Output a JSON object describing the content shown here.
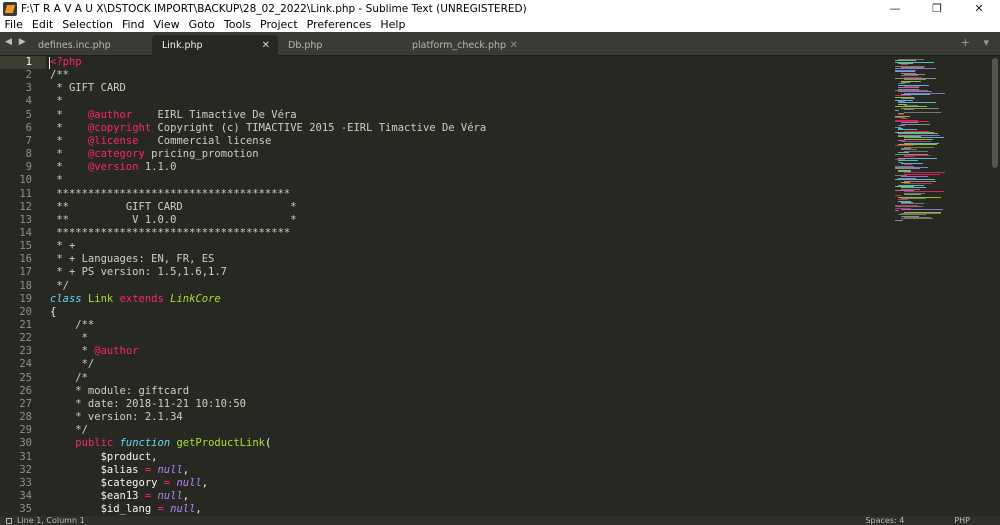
{
  "window": {
    "title": "F:\\T R A V A U X\\DSTOCK IMPORT\\BACKUP\\28_02_2022\\Link.php - Sublime Text (UNREGISTERED)",
    "minimize": "—",
    "maximize": "❐",
    "close": "✕"
  },
  "menu": [
    "File",
    "Edit",
    "Selection",
    "Find",
    "View",
    "Goto",
    "Tools",
    "Project",
    "Preferences",
    "Help"
  ],
  "tabs": [
    {
      "label": "defines.inc.php",
      "active": false
    },
    {
      "label": "Link.php",
      "active": true
    },
    {
      "label": "Db.php",
      "active": false
    },
    {
      "label": "platform_check.php",
      "active": false
    }
  ],
  "tabbar": {
    "nav": "◀ ▶",
    "right": "+ ▾"
  },
  "editor": {
    "current_line": 1,
    "lines": [
      "<?php",
      "/**",
      " * GIFT CARD",
      " *",
      " *    @author    EIRL Timactive De Véra",
      " *    @copyright Copyright (c) TIMACTIVE 2015 -EIRL Timactive De Véra",
      " *    @license   Commercial license",
      " *    @category pricing_promotion",
      " *    @version 1.1.0",
      " *",
      " *************************************",
      " **         GIFT CARD                 *",
      " **          V 1.0.0                  *",
      " *************************************",
      " * +",
      " * + Languages: EN, FR, ES",
      " * + PS version: 1.5,1.6,1.7",
      " */",
      "class Link extends LinkCore",
      "{",
      "    /**",
      "     *",
      "     * @author",
      "     */",
      "    /*",
      "    * module: giftcard",
      "    * date: 2018-11-21 10:10:50",
      "    * version: 2.1.34",
      "    */",
      "    public function getProductLink(",
      "        $product,",
      "        $alias = null,",
      "        $category = null,",
      "        $ean13 = null,",
      "        $id_lang = null,"
    ]
  },
  "status": {
    "position": "Line 1, Column 1",
    "indent": "Spaces: 4",
    "syntax": "PHP"
  }
}
